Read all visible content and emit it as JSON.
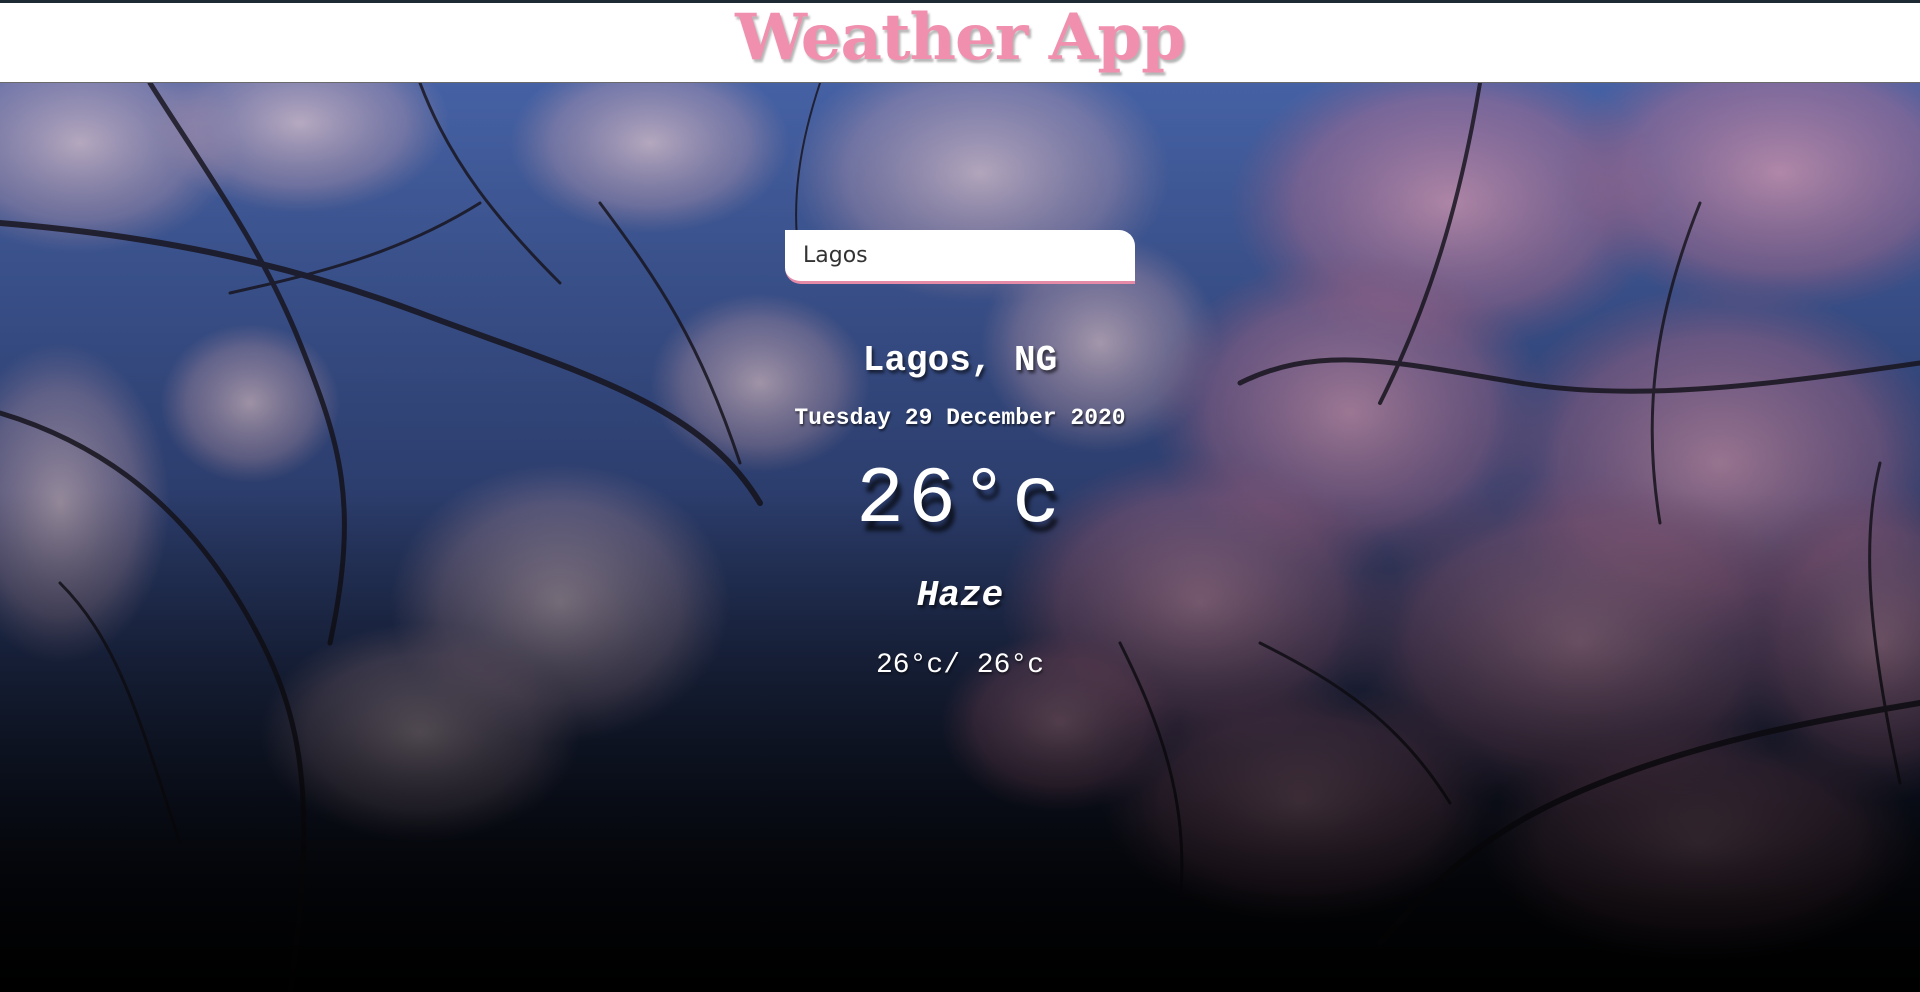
{
  "header": {
    "title": "Weather App",
    "title_color": "#f08fae"
  },
  "search": {
    "value": "Lagos"
  },
  "weather": {
    "location": "Lagos, NG",
    "date": "Tuesday 29 December 2020",
    "temperature": "26°c",
    "condition": "Haze",
    "hi_low": "26°c/ 26°c"
  },
  "background": {
    "subject": "cherry-blossom-branches",
    "sky_color": "#4a67b0",
    "blossom_color": "#d9a2c2"
  }
}
